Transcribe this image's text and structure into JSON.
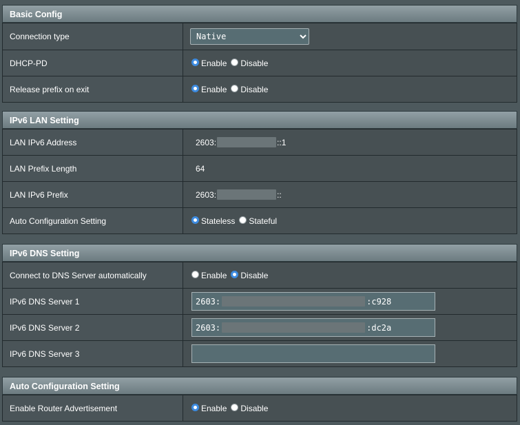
{
  "basic": {
    "title": "Basic Config",
    "connection_type_label": "Connection type",
    "connection_type_value": "Native",
    "dhcp_pd_label": "DHCP-PD",
    "release_label": "Release prefix on exit",
    "enable": "Enable",
    "disable": "Disable"
  },
  "lan": {
    "title": "IPv6 LAN Setting",
    "address_label": "LAN IPv6 Address",
    "address_prefix": "2603:",
    "address_suffix": "::1",
    "prefix_length_label": "LAN Prefix Length",
    "prefix_length_value": "64",
    "prefix_label": "LAN IPv6 Prefix",
    "prefix_prefix": "2603:",
    "prefix_suffix": "::",
    "autoconf_label": "Auto Configuration Setting",
    "stateless": "Stateless",
    "stateful": "Stateful"
  },
  "dns": {
    "title": "IPv6 DNS Setting",
    "auto_label": "Connect to DNS Server automatically",
    "enable": "Enable",
    "disable": "Disable",
    "server1_label": "IPv6 DNS Server 1",
    "server1_prefix": "2603:",
    "server1_suffix": ":c928",
    "server2_label": "IPv6 DNS Server 2",
    "server2_prefix": "2603:",
    "server2_suffix": ":dc2a",
    "server3_label": "IPv6 DNS Server 3",
    "server3_value": ""
  },
  "autoconf": {
    "title": "Auto Configuration Setting",
    "router_adv_label": "Enable Router Advertisement",
    "enable": "Enable",
    "disable": "Disable"
  },
  "colors": {
    "radio_checked": "#3d8be0",
    "header_top": "#92a0a5",
    "header_bottom": "#6c7b80",
    "page_bg": "#4d595d"
  }
}
